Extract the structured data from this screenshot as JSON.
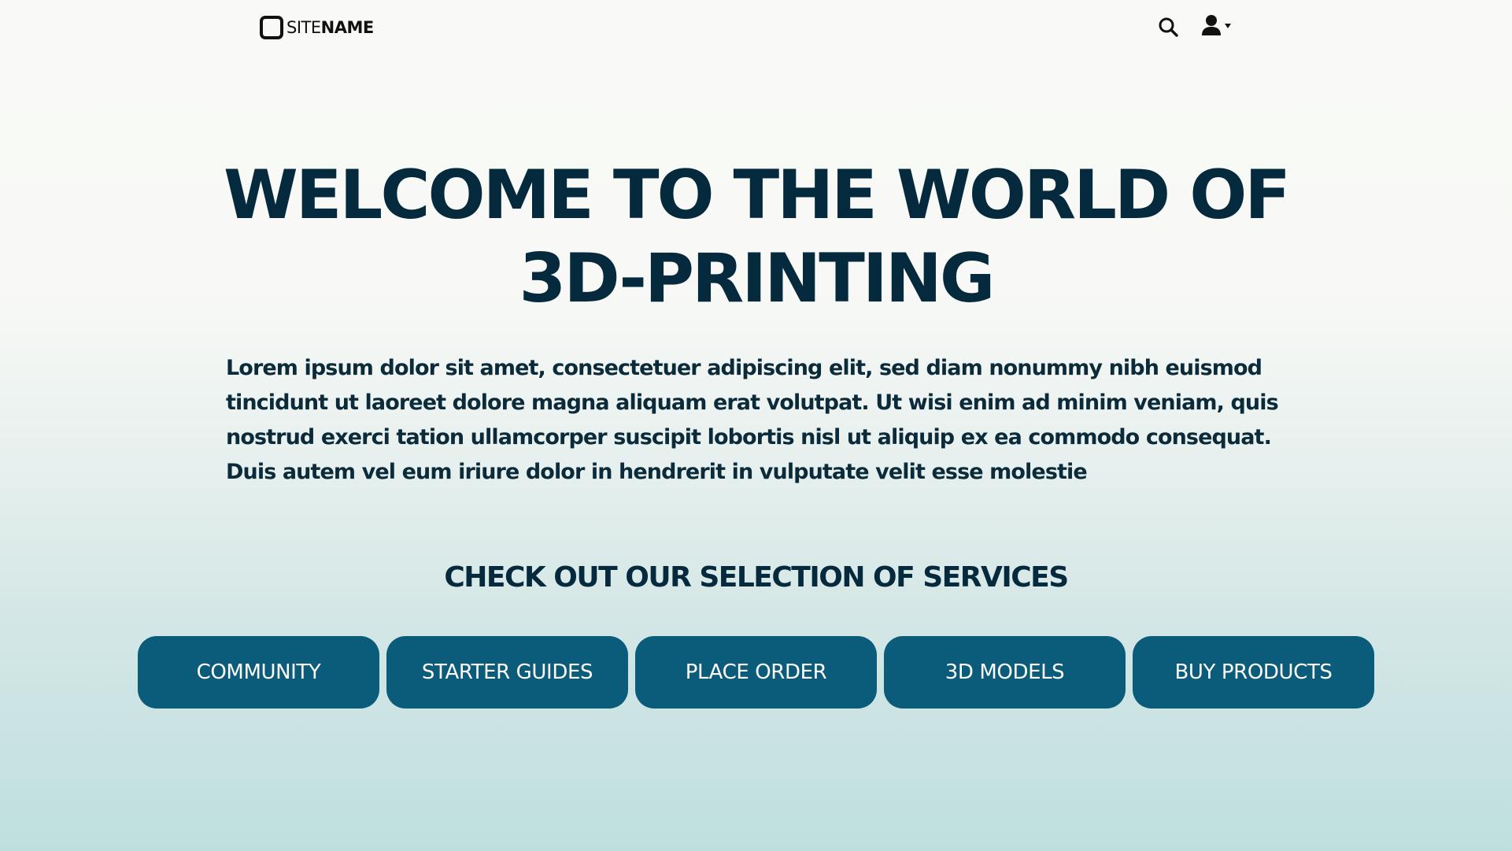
{
  "header": {
    "logo": {
      "prefix": "SITE",
      "suffix": "NAME"
    },
    "icons": {
      "search": "search-icon",
      "user": "user-icon",
      "dropdown": "caret-down-icon"
    }
  },
  "hero": {
    "title_line1": "WELCOME TO THE WORLD OF",
    "title_line2": "3D-PRINTING",
    "text": "Lorem ipsum dolor sit amet, consectetuer adipiscing elit, sed diam nonummy nibh euismod tincidunt ut laoreet dolore magna aliquam erat volutpat. Ut wisi enim ad minim veniam, quis nostrud exerci tation ullamcorper suscipit lobortis nisl ut aliquip ex ea commodo consequat. Duis autem vel eum iriure dolor in hendrerit in vulputate velit esse molestie"
  },
  "services": {
    "heading": "CHECK OUT OUR SELECTION OF SERVICES",
    "buttons": [
      {
        "label": "COMMUNITY"
      },
      {
        "label": "STARTER GUIDES"
      },
      {
        "label": "PLACE ORDER"
      },
      {
        "label": "3D MODELS"
      },
      {
        "label": "BUY PRODUCTS"
      }
    ]
  },
  "colors": {
    "primary_dark": "#062a3d",
    "button": "#0b5b7a",
    "button_text": "#ffffff"
  }
}
